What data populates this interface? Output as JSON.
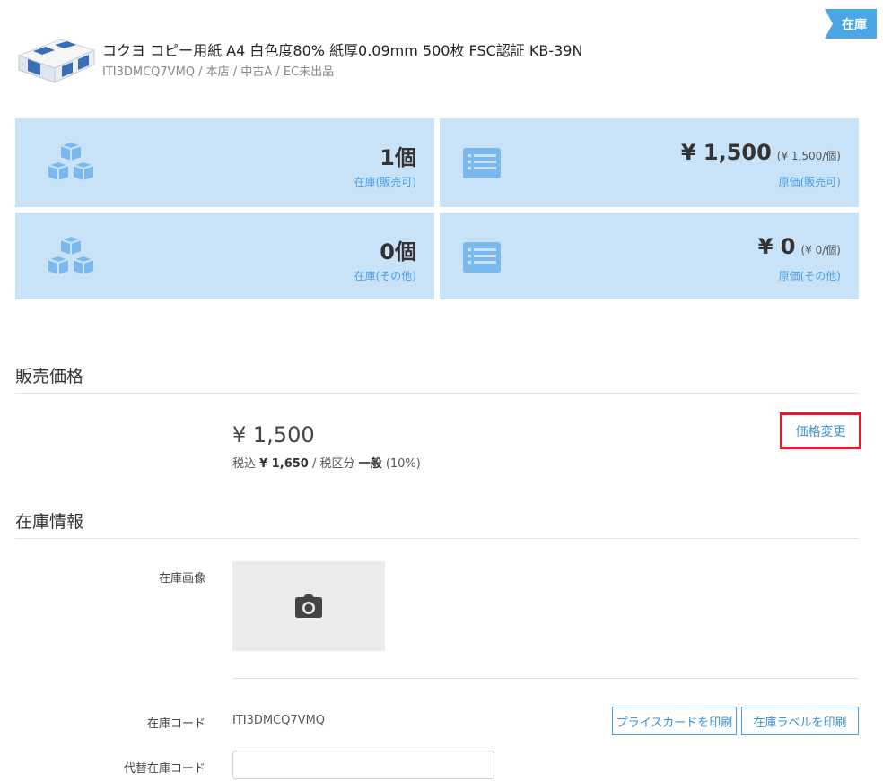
{
  "status_badge": "在庫",
  "product": {
    "title": "コクヨ コピー用紙 A4 白色度80% 紙厚0.09mm 500枚 FSC認証 KB-39N",
    "subtitle": "ITI3DMCQ7VMQ / 本店 / 中古A / EC未出品"
  },
  "stats": {
    "stock_sellable": {
      "value": "1個",
      "label": "在庫(販売可)"
    },
    "cost_sellable": {
      "value": "¥ 1,500",
      "unit": "(¥ 1,500/個)",
      "label": "原価(販売可)"
    },
    "stock_other": {
      "value": "0個",
      "label": "在庫(その他)"
    },
    "cost_other": {
      "value": "¥ 0",
      "unit": "(¥ 0/個)",
      "label": "原価(その他)"
    }
  },
  "price_section": {
    "title": "販売価格",
    "price": "¥ 1,500",
    "tax_prefix": "税込",
    "tax_incl": "¥ 1,650",
    "tax_mid": "/ 税区分",
    "tax_class": "一般",
    "tax_rate": "(10%)",
    "change_button": "価格変更"
  },
  "stock_section": {
    "title": "在庫情報",
    "image_label": "在庫画像",
    "code_label": "在庫コード",
    "code_value": "ITI3DMCQ7VMQ",
    "print_price_card": "プライスカードを印刷",
    "print_stock_label": "在庫ラベルを印刷",
    "alt_code_label": "代替在庫コード",
    "alt_code_value": ""
  },
  "colors": {
    "accent": "#4ba6e6",
    "card_bg": "#c8e2f8",
    "highlight": "#e8192c"
  },
  "icons": [
    "boxes-icon",
    "list-icon",
    "camera-icon"
  ]
}
